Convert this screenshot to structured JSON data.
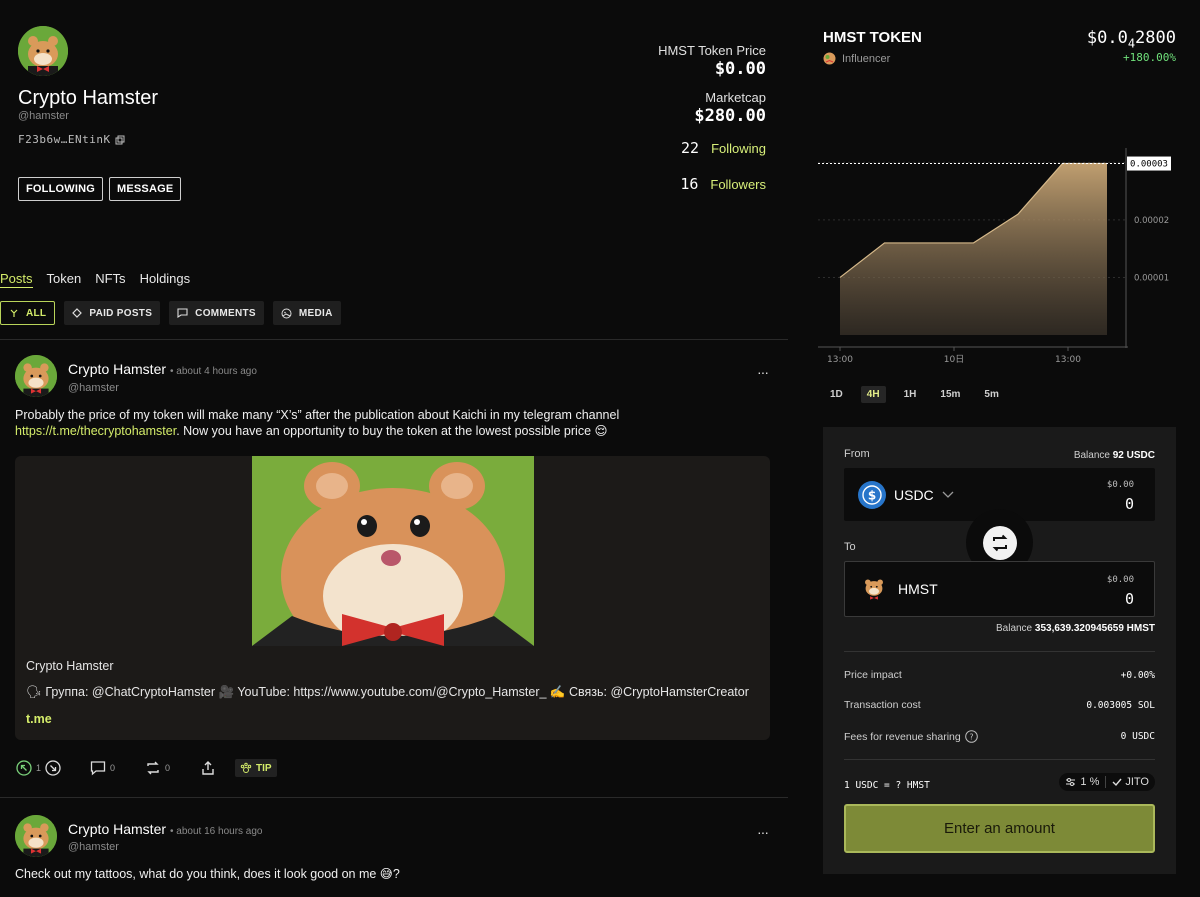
{
  "profile": {
    "name": "Crypto Hamster",
    "handle": "@hamster",
    "wallet": "F23b6w…ENtinK",
    "following_btn": "FOLLOWING",
    "message_btn": "MESSAGE",
    "token_price_label": "HMST Token Price",
    "token_price_value": "$0.00",
    "marketcap_label": "Marketcap",
    "marketcap_value": "$280.00",
    "following_count": "22",
    "following_label": "Following",
    "followers_count": "16",
    "followers_label": "Followers"
  },
  "tabs": [
    "Posts",
    "Token",
    "NFTs",
    "Holdings"
  ],
  "filters": [
    "ALL",
    "PAID POSTS",
    "COMMENTS",
    "MEDIA"
  ],
  "posts": [
    {
      "name": "Crypto Hamster",
      "time": "• about 4 hours ago",
      "handle": "@hamster",
      "text_line1": "Probably the price of my token will make many “X’s” after the publication about Kaichi in my telegram channel",
      "link": "https://t.me/thecryptohamster",
      "text_line2": ". Now you have an opportunity to buy the token at the lowest possible price 😌",
      "card_title": "Crypto Hamster",
      "card_desc": "🗣 Группа: @ChatCryptoHamster 🎥 YouTube: https://www.youtube.com/@Crypto_Hamster_ ✍️ Связь: @CryptoHamsterCreator",
      "card_link": "t.me",
      "likes": "1",
      "comments": "0",
      "reposts": "0",
      "tip": "TIP"
    },
    {
      "name": "Crypto Hamster",
      "time": "• about 16 hours ago",
      "handle": "@hamster",
      "text": "Check out my tattoos, what do you think, does it look good on me 😅?"
    }
  ],
  "token": {
    "title": "HMST TOKEN",
    "badge": "Influencer",
    "price_main": "$0.0",
    "price_sub": "4",
    "price_rest": "2800",
    "change": "+180.00%"
  },
  "chart_data": {
    "type": "area",
    "x_ticks": [
      "13:00",
      "10日",
      "13:00"
    ],
    "y_ticks": [
      "0.00003",
      "0.00002",
      "0.00001"
    ],
    "current_value": "0.00003",
    "x": [
      0,
      1,
      2,
      3,
      4,
      5,
      6
    ],
    "values": [
      1e-05,
      1.6e-05,
      1.6e-05,
      1.6e-05,
      2.1e-05,
      2.98e-05,
      2.98e-05
    ],
    "ylim": [
      0,
      3.25e-05
    ],
    "timeframes": [
      "1D",
      "4H",
      "1H",
      "15m",
      "5m"
    ],
    "active_timeframe": "4H"
  },
  "swap": {
    "from_label": "From",
    "from_balance_label": "Balance",
    "from_balance_value": "92 USDC",
    "from_token": "USDC",
    "from_usd": "$0.00",
    "from_amount": "0",
    "to_label": "To",
    "to_token": "HMST",
    "to_usd": "$0.00",
    "to_amount": "0",
    "to_balance_label": "Balance",
    "to_balance_value": "353,639.320945659 HMST",
    "price_impact_label": "Price impact",
    "price_impact_value": "+0.00%",
    "tx_cost_label": "Transaction cost",
    "tx_cost_value": "0.003005 SOL",
    "fees_label": "Fees for revenue sharing",
    "fees_value": "0 USDC",
    "rate": "1 USDC = ? HMST",
    "slippage": "1 %",
    "jito": "JITO",
    "cta": "Enter an amount"
  },
  "colors": {
    "accent": "#d4ec6a",
    "positive": "#6fe07a",
    "cta": "#7d8a37"
  }
}
